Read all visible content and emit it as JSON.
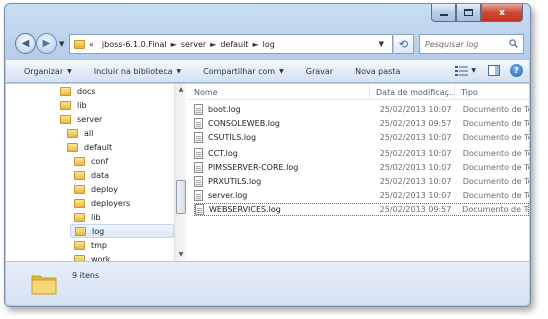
{
  "window": {
    "controls": {
      "close_label": "x"
    }
  },
  "address_bar": {
    "overflow_glyph": "«",
    "separator": "►",
    "crumbs": [
      "jboss-6.1.0.Final",
      "server",
      "default",
      "log"
    ],
    "search_placeholder": "Pesquisar log"
  },
  "toolbar": {
    "items": [
      {
        "label": "Organizar",
        "has_menu": true
      },
      {
        "label": "Incluir na biblioteca",
        "has_menu": true
      },
      {
        "label": "Compartilhar com",
        "has_menu": true
      },
      {
        "label": "Gravar",
        "has_menu": false
      },
      {
        "label": "Nova pasta",
        "has_menu": false
      }
    ],
    "help_label": "?"
  },
  "tree": {
    "items": [
      {
        "label": "docs",
        "level": 0,
        "selected": false
      },
      {
        "label": "lib",
        "level": 0,
        "selected": false
      },
      {
        "label": "server",
        "level": 0,
        "selected": false
      },
      {
        "label": "all",
        "level": 1,
        "selected": false
      },
      {
        "label": "default",
        "level": 1,
        "selected": false
      },
      {
        "label": "conf",
        "level": 2,
        "selected": false
      },
      {
        "label": "data",
        "level": 2,
        "selected": false
      },
      {
        "label": "deploy",
        "level": 2,
        "selected": false
      },
      {
        "label": "deployers",
        "level": 2,
        "selected": false
      },
      {
        "label": "lib",
        "level": 2,
        "selected": false
      },
      {
        "label": "log",
        "level": 2,
        "selected": true
      },
      {
        "label": "tmp",
        "level": 2,
        "selected": false
      },
      {
        "label": "work",
        "level": 2,
        "selected": false
      }
    ]
  },
  "file_list": {
    "columns": [
      "Nome",
      "Data de modificaç...",
      "Tipo"
    ],
    "rows": [
      {
        "name": "boot.log",
        "date": "25/02/2013 10:07",
        "type": "Documento de Te...",
        "selected": false
      },
      {
        "name": "CONSOLEWEB.log",
        "date": "25/02/2013 09:57",
        "type": "Documento de Te...",
        "selected": false
      },
      {
        "name": "CSUTILS.log",
        "date": "25/02/2013 10:07",
        "type": "Documento de Te...",
        "selected": false
      },
      {
        "name": "CCT.log",
        "date": "25/02/2013 10:07",
        "type": "Documento de Te...",
        "selected": false
      },
      {
        "name": "PIMSSERVER-CORE.log",
        "date": "25/02/2013 10:07",
        "type": "Documento de Te...",
        "selected": false
      },
      {
        "name": "PRXUTILS.log",
        "date": "25/02/2013 10:07",
        "type": "Documento de Te...",
        "selected": false
      },
      {
        "name": "server.log",
        "date": "25/02/2013 10:07",
        "type": "Documento de Te...",
        "selected": false
      },
      {
        "name": "WEBSERVICES.log",
        "date": "25/02/2013 09:57",
        "type": "Documento de Te...",
        "selected": true
      }
    ]
  },
  "status_bar": {
    "item_count": "9 itens"
  }
}
